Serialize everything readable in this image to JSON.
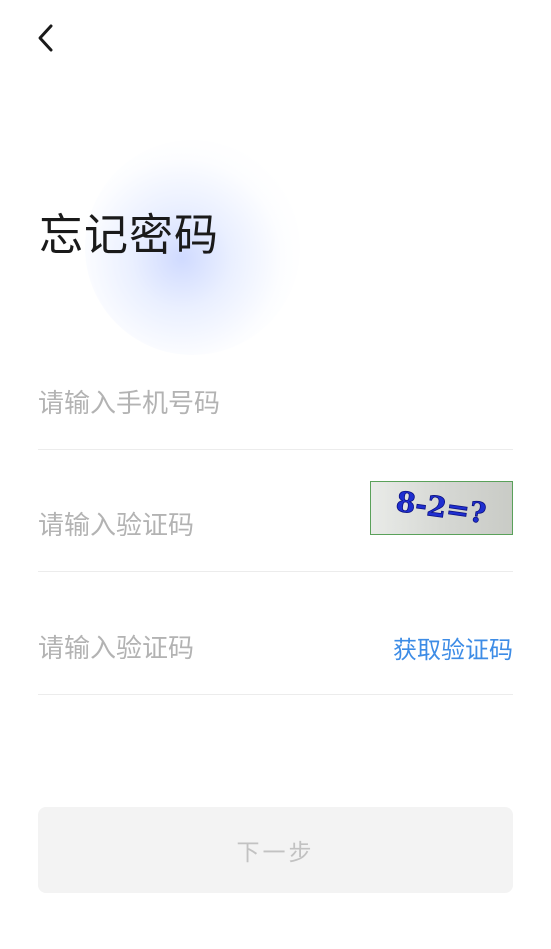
{
  "header": {
    "back_icon": "chevron-left-icon"
  },
  "page": {
    "title": "忘记密码"
  },
  "form": {
    "phone_placeholder": "请输入手机号码",
    "captcha_placeholder": "请输入验证码",
    "captcha_text": "8-2=?",
    "sms_placeholder": "请输入验证码",
    "get_code_label": "获取验证码",
    "get_code_color": "#3d8ce6"
  },
  "actions": {
    "next_label": "下一步"
  }
}
